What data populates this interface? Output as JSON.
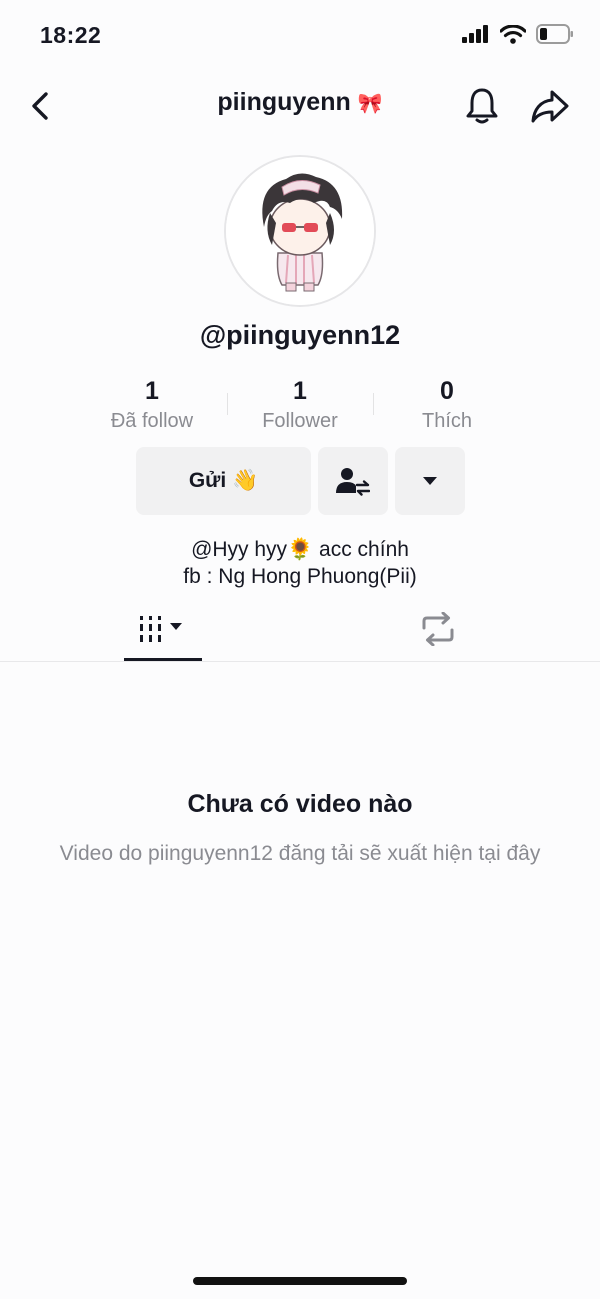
{
  "status_bar": {
    "time": "18:22"
  },
  "header": {
    "title": "piinguyenn",
    "title_symbol": "🎀"
  },
  "profile": {
    "handle": "@piinguyenn12",
    "stats": [
      {
        "value": "1",
        "label": "Đã follow"
      },
      {
        "value": "1",
        "label": "Follower"
      },
      {
        "value": "0",
        "label": "Thích"
      }
    ],
    "send_button_label": "Gửi 👋",
    "bio_line1": "@Hyy hyy🌻 acc chính",
    "bio_line2": "fb : Ng Hong Phuong(Pii)"
  },
  "empty_state": {
    "title": "Chưa có video nào",
    "subtitle": "Video do piinguyenn12 đăng tải sẽ xuất hiện tại đây"
  },
  "icons": {
    "back": "chevron-left-icon",
    "bell": "bell-icon",
    "share": "share-arrow-icon",
    "friends": "user-swap-icon",
    "more": "caret-down-icon",
    "videos_tab": "grid-columns-icon",
    "repost_tab": "repost-icon"
  }
}
